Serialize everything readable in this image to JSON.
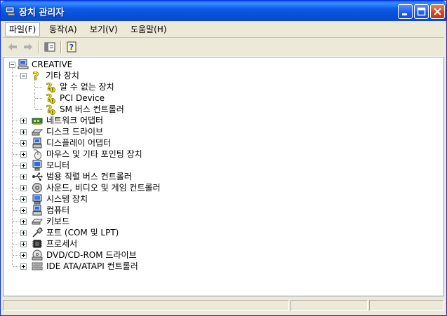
{
  "window": {
    "title": "장치 관리자"
  },
  "menu": [
    {
      "label": "파일(F)"
    },
    {
      "label": "동작(A)"
    },
    {
      "label": "보기(V)"
    },
    {
      "label": "도움말(H)"
    }
  ],
  "tree": {
    "root": "CREATIVE",
    "other_devices": {
      "label": "기타 장치",
      "children": [
        "알 수 없는 장치",
        "PCI Device",
        "SM 버스 컨트롤러"
      ]
    },
    "categories": [
      {
        "label": "네트워크 어댑터",
        "icon": "network-adapter-icon"
      },
      {
        "label": "디스크 드라이브",
        "icon": "disk-drive-icon"
      },
      {
        "label": "디스플레이 어댑터",
        "icon": "display-adapter-icon"
      },
      {
        "label": "마우스 및 기타 포인팅 장치",
        "icon": "mouse-icon"
      },
      {
        "label": "모니터",
        "icon": "monitor-icon"
      },
      {
        "label": "범용 직렬 버스 컨트롤러",
        "icon": "usb-icon"
      },
      {
        "label": "사운드, 비디오 및 게임 컨트롤러",
        "icon": "sound-icon"
      },
      {
        "label": "시스템 장치",
        "icon": "system-device-icon"
      },
      {
        "label": "컴퓨터",
        "icon": "computer-icon"
      },
      {
        "label": "키보드",
        "icon": "keyboard-icon"
      },
      {
        "label": "포트 (COM 및 LPT)",
        "icon": "port-icon"
      },
      {
        "label": "프로세서",
        "icon": "processor-icon"
      },
      {
        "label": "DVD/CD-ROM 드라이브",
        "icon": "dvd-drive-icon"
      },
      {
        "label": "IDE ATA/ATAPI 컨트롤러",
        "icon": "ide-controller-icon"
      }
    ]
  },
  "colors": {
    "titlebar": "#0A5FF6",
    "chrome": "#ECE9D8",
    "warning": "#F7E600"
  }
}
